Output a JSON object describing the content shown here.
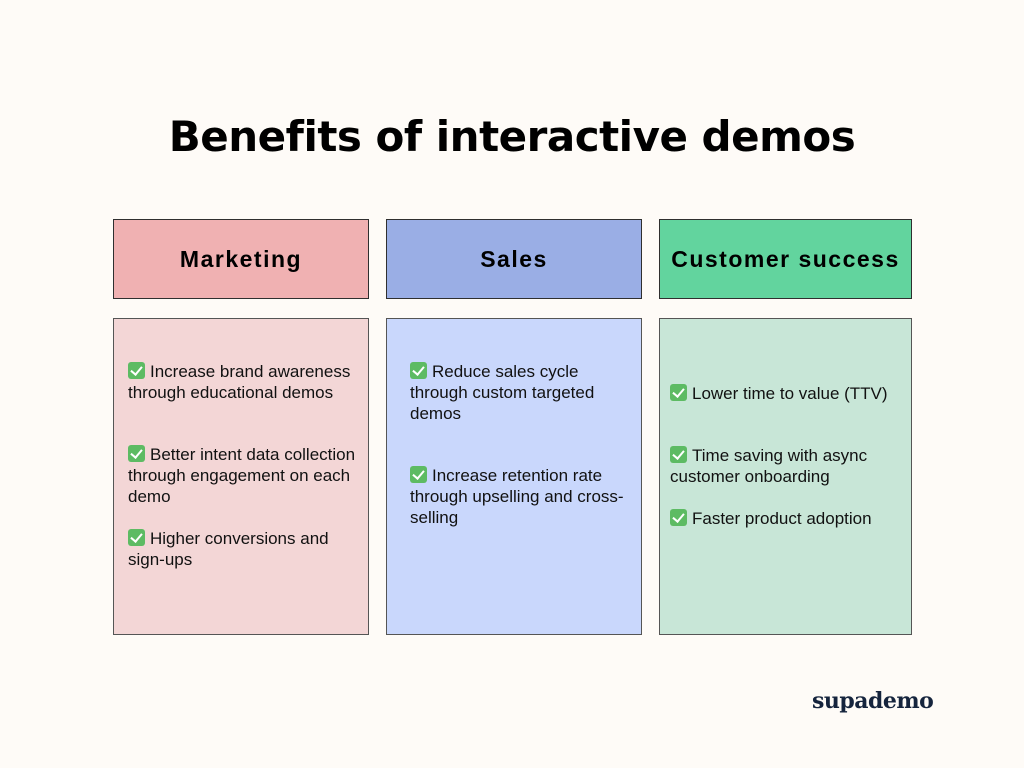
{
  "title": "Benefits of interactive demos",
  "columns": [
    {
      "heading": "Marketing",
      "header_color": "#f0b1b2",
      "panel_color": "#f3d6d6",
      "items": [
        "Increase brand awareness through educational demos",
        "Better intent data collection through engagement on each demo",
        "Higher conversions and sign-ups"
      ]
    },
    {
      "heading": "Sales",
      "header_color": "#9aaee5",
      "panel_color": "#c9d7fc",
      "items": [
        "Reduce sales cycle through custom targeted demos",
        "Increase retention rate through upselling and cross-selling"
      ]
    },
    {
      "heading": "Customer success",
      "header_color": "#62d49e",
      "panel_color": "#c8e6d7",
      "items": [
        "Lower time to value (TTV)",
        "Time saving with async customer onboarding",
        "Faster product adoption"
      ]
    }
  ],
  "icons": {
    "bullet": "check-mark-button-icon"
  },
  "brand": "supademo"
}
